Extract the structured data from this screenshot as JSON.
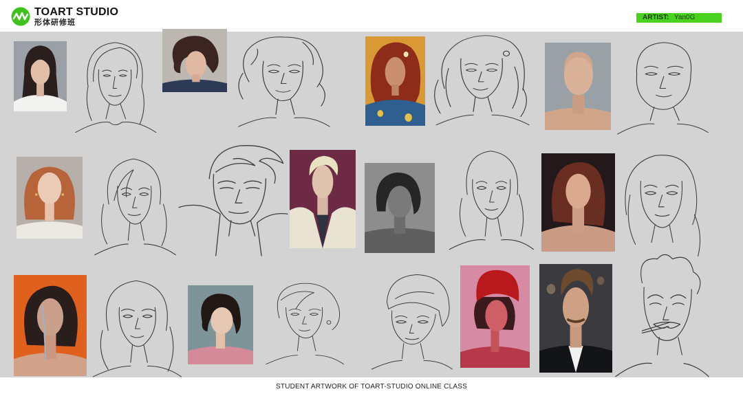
{
  "header": {
    "logo_title": "TOART STUDIO",
    "logo_subtitle": "形体研修班",
    "artist_label": "ARTIST:",
    "artist_name": "Yan0G"
  },
  "footer": {
    "caption": "STUDENT ARTWORK OF TOART-STUDIO ONLINE CLASS"
  },
  "colors": {
    "accent_green": "#4bd21e",
    "board_gray": "#d3d3d3",
    "sketch_line": "#3c3c3c"
  },
  "icons": {
    "logo": "toart-logo-icon"
  }
}
